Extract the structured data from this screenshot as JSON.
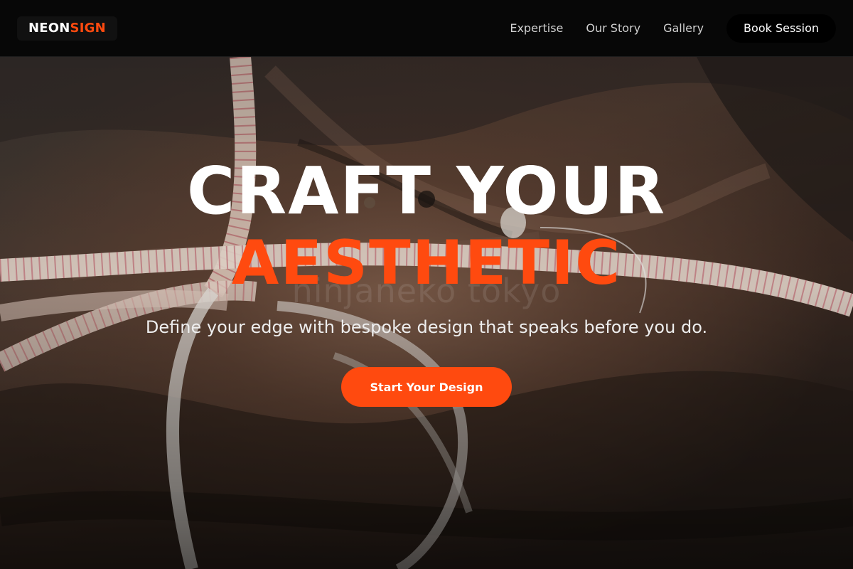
{
  "header": {
    "logo": {
      "part1": "NEON",
      "part2": "SIGN"
    },
    "nav": [
      {
        "label": "Expertise"
      },
      {
        "label": "Our Story"
      },
      {
        "label": "Gallery"
      }
    ],
    "book_label": "Book Session"
  },
  "hero": {
    "title_line1": "CRAFT YOUR",
    "title_line2": "AESTHETIC",
    "subtitle": "Define your edge with bespoke design that speaks before you do.",
    "cta_label": "Start Your Design",
    "watermark": "ninjaneko tokyo"
  },
  "colors": {
    "accent": "#ff4a0f",
    "header_bg": "#070707",
    "text_primary": "#ffffff"
  }
}
